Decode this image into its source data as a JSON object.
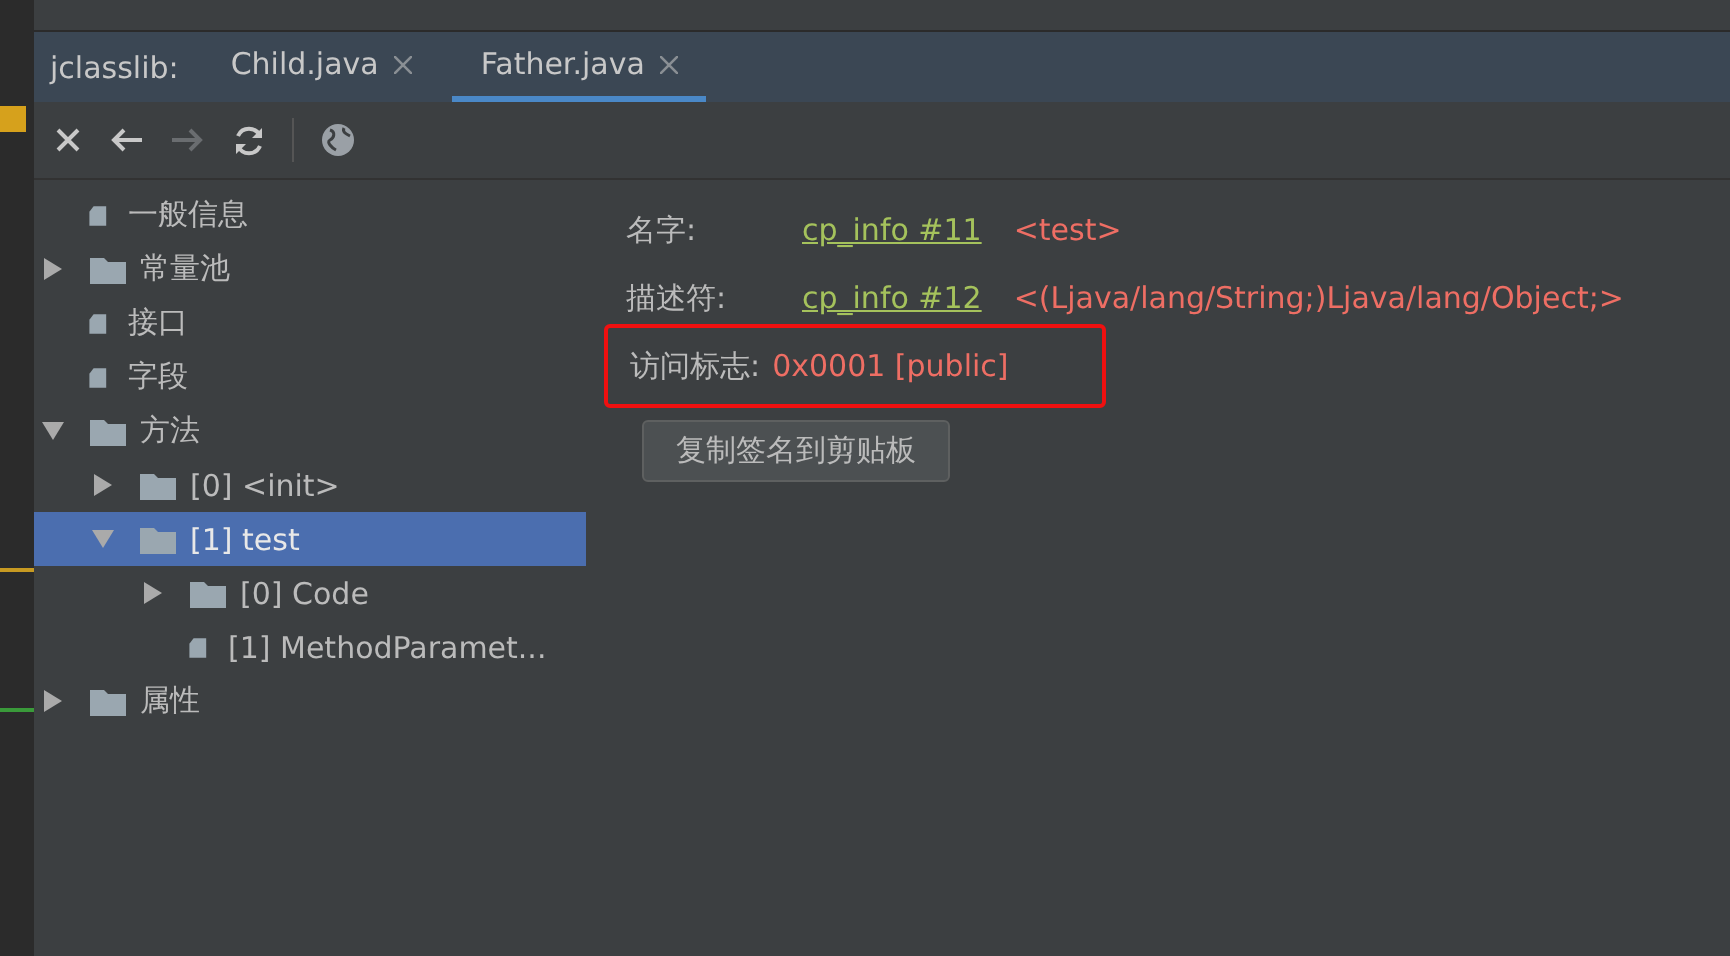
{
  "tabs_label": "jclasslib:",
  "tabs": [
    {
      "label": "Child.java",
      "selected": false
    },
    {
      "label": "Father.java",
      "selected": true
    }
  ],
  "tree": [
    {
      "label": "一般信息",
      "kind": "file"
    },
    {
      "label": "常量池",
      "kind": "folder",
      "expanded": false
    },
    {
      "label": "接口",
      "kind": "file"
    },
    {
      "label": "字段",
      "kind": "file"
    },
    {
      "label": "方法",
      "kind": "folder",
      "expanded": true,
      "selected": false,
      "children": [
        {
          "label": "[0] <init>",
          "kind": "folder",
          "expanded": false,
          "selected": false
        },
        {
          "label": "[1] test",
          "kind": "folder",
          "expanded": true,
          "selected": true,
          "children": [
            {
              "label": "[0] Code",
              "kind": "folder",
              "expanded": false,
              "selected": false
            },
            {
              "label": "[1] MethodParamet...",
              "kind": "file",
              "selected": false
            }
          ]
        }
      ]
    },
    {
      "label": "属性",
      "kind": "folder",
      "expanded": false
    }
  ],
  "details": [
    {
      "label": "名字:",
      "link": "cp_info #11",
      "value": "<test>"
    },
    {
      "label": "描述符:",
      "link": "cp_info #12",
      "value": "<(Ljava/lang/String;)Ljava/lang/Object;>"
    }
  ],
  "access": {
    "label": "访问标志:",
    "value": "0x0001 [public]",
    "highlighted": true
  },
  "copy_button": "复制签名到剪贴板"
}
